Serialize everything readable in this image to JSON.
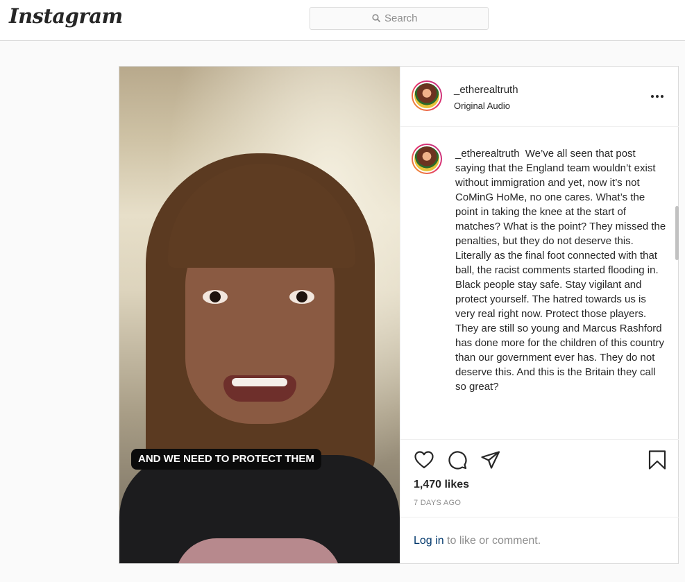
{
  "nav": {
    "logo": "Instagram",
    "search_placeholder": "Search",
    "search_icon": "search-icon"
  },
  "post": {
    "video_caption": "AND WE NEED TO PROTECT THEM",
    "author": {
      "username": "_etherealtruth",
      "subtitle": "Original Audio"
    },
    "more_icon": "more-options-icon",
    "caption": {
      "username": "_etherealtruth",
      "text": "We’ve all seen that post saying that the England team wouldn’t exist without immigration and yet, now it’s not CoMinG HoMe, no one cares. What’s the point in taking the knee at the start of matches? What is the point? They missed the penalties, but they do not deserve this. Literally as the final foot connected with that ball, the racist comments started flooding in. Black people stay safe. Stay vigilant and protect yourself. The hatred towards us is very real right now. Protect those players. They are still so young and Marcus Rashford has done more for the children of this country than our government ever has. They do not deserve this. And this is the Britain they call so great?"
    },
    "actions": {
      "like_icon": "heart-icon",
      "comment_icon": "comment-icon",
      "share_icon": "share-icon",
      "save_icon": "bookmark-icon"
    },
    "likes": "1,470 likes",
    "posted": "7 DAYS AGO",
    "login": {
      "link": "Log in",
      "rest": " to like or comment."
    }
  },
  "colors": {
    "link": "#00376b",
    "border": "#dbdbdb",
    "muted": "#8e8e8e",
    "text": "#262626"
  }
}
